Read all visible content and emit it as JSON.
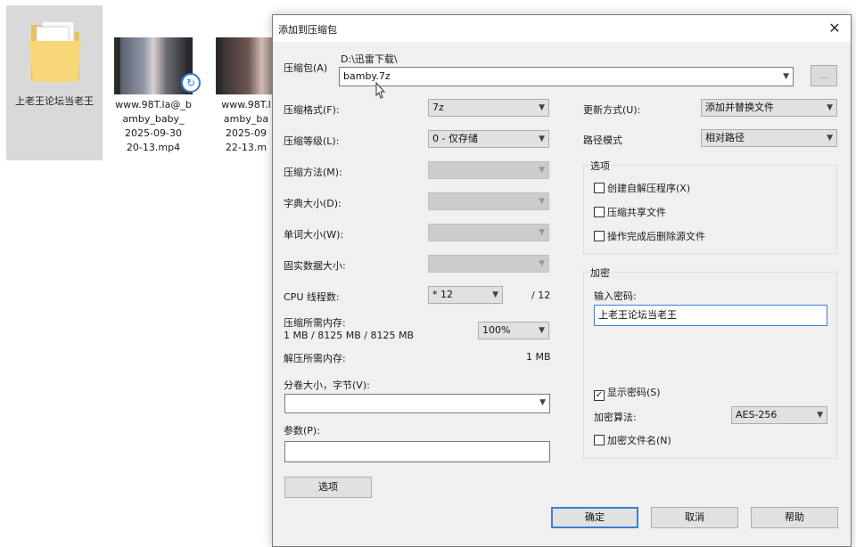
{
  "desktop": {
    "folder": {
      "label": "上老王论坛当老王",
      "icon": "folder-icon"
    },
    "videos": [
      {
        "label_lines": [
          "www.98T.la@_b",
          "amby_baby_",
          "2025-09-30",
          "20-13.mp4"
        ]
      },
      {
        "label_lines": [
          "www.98T.l",
          "amby_ba",
          "2025-09",
          "22-13.m"
        ]
      }
    ]
  },
  "dialog": {
    "title": "添加到压缩包",
    "close": "✕",
    "archive": {
      "label": "压缩包(A)",
      "path": "D:\\迅雷下载\\",
      "name": "bamby.7z",
      "browse": "..."
    },
    "left": {
      "format": {
        "label": "压缩格式(F):",
        "value": "7z"
      },
      "level": {
        "label": "压缩等级(L):",
        "value": "0 - 仅存储"
      },
      "method": {
        "label": "压缩方法(M):",
        "value": ""
      },
      "dict": {
        "label": "字典大小(D):",
        "value": ""
      },
      "word": {
        "label": "单词大小(W):",
        "value": ""
      },
      "solid": {
        "label": "固实数据大小:",
        "value": ""
      },
      "threads": {
        "label": "CPU 线程数:",
        "value": "* 12",
        "max": "/ 12"
      },
      "mem_compress": {
        "label": "压缩所需内存:",
        "detail": "1 MB / 8125 MB / 8125 MB",
        "value": "100%"
      },
      "mem_decompress": {
        "label": "解压所需内存:",
        "value": "1 MB"
      },
      "split": {
        "label": "分卷大小，字节(V):",
        "value": ""
      },
      "params": {
        "label": "参数(P):",
        "value": ""
      },
      "options_button": "选项"
    },
    "right": {
      "update": {
        "label": "更新方式(U):",
        "value": "添加并替换文件"
      },
      "path_mode": {
        "label": "路径模式",
        "value": "相对路径"
      },
      "options": {
        "title": "选项",
        "items": [
          {
            "label": "创建自解压程序(X)",
            "checked": false
          },
          {
            "label": "压缩共享文件",
            "checked": false
          },
          {
            "label": "操作完成后删除源文件",
            "checked": false
          }
        ]
      },
      "encryption": {
        "title": "加密",
        "password_label": "输入密码:",
        "password": "上老王论坛当老王",
        "show_password": {
          "label": "显示密码(S)",
          "checked": true
        },
        "method_label": "加密算法:",
        "method": "AES-256",
        "encrypt_names": {
          "label": "加密文件名(N)",
          "checked": false
        }
      }
    },
    "buttons": {
      "ok": "确定",
      "cancel": "取消",
      "help": "帮助"
    }
  },
  "colors": {
    "dialog_bg": "#f0f0f0",
    "focus_border": "#3c7fd0",
    "selection": "#d9d9d9"
  }
}
